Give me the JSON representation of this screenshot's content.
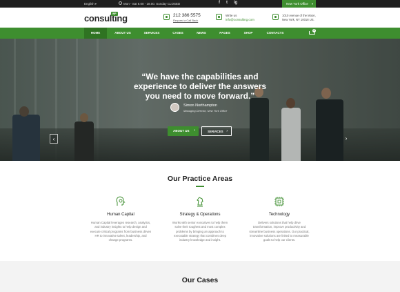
{
  "topbar": {
    "language": "English",
    "hours": "Mon - Sat 8.00 - 18.00. Sunday CLOSED",
    "social": [
      "f",
      "t",
      "ig"
    ],
    "office": "New York Office"
  },
  "header": {
    "logo": "consulting",
    "logo_badge": "WP",
    "phone": "212 386 5575",
    "phone_sub": "Request a Call Back",
    "write_label": "Write us",
    "email": "info@consulting.com",
    "address_line1": "1010 Avenue of the Moon,",
    "address_line2": "New York, NY 10018 US."
  },
  "nav": {
    "items": [
      "HOME",
      "ABOUT US",
      "SERVICES",
      "CASES",
      "NEWS",
      "PAGES",
      "SHOP",
      "CONTACTS"
    ],
    "active": "HOME",
    "cart_count": "0"
  },
  "hero": {
    "quote_line1": "“We have the capabilities and",
    "quote_line2": "experience to deliver the answers",
    "quote_line3": "you need to move forward.”",
    "author_name": "Simon Northampton",
    "author_role": "Managing Director, New York Office",
    "btn_about": "ABOUT US",
    "btn_services": "SERVICES"
  },
  "practice": {
    "title": "Our Practice Areas",
    "areas": [
      {
        "title": "Human Capital",
        "icon": "head-gear-icon",
        "desc": [
          "Human Capital leverages research, analytics,",
          "and industry insights to help design and",
          "execute critical programs from business driven",
          "HR to innovative talent, leadership, and",
          "change programs."
        ]
      },
      {
        "title": "Strategy & Operations",
        "icon": "chess-knight-icon",
        "desc": [
          "Works with senior executives to help them",
          "solve their toughest and most complex",
          "problems by bringing an approach to",
          "executable strategy that combines deep",
          "industry knowledge and insight."
        ]
      },
      {
        "title": "Technology",
        "icon": "chip-icon",
        "desc": [
          "Delivers solutions that help drive",
          "transformation, improve productivity and",
          "streamline business operations. Our practical,",
          "innovative solutions are linked to measurable",
          "goals to help our clients."
        ]
      }
    ]
  },
  "cases": {
    "title": "Our Cases"
  },
  "colors": {
    "brand_green": "#3e8e2f",
    "topbar_dark": "#1e1e1e"
  }
}
